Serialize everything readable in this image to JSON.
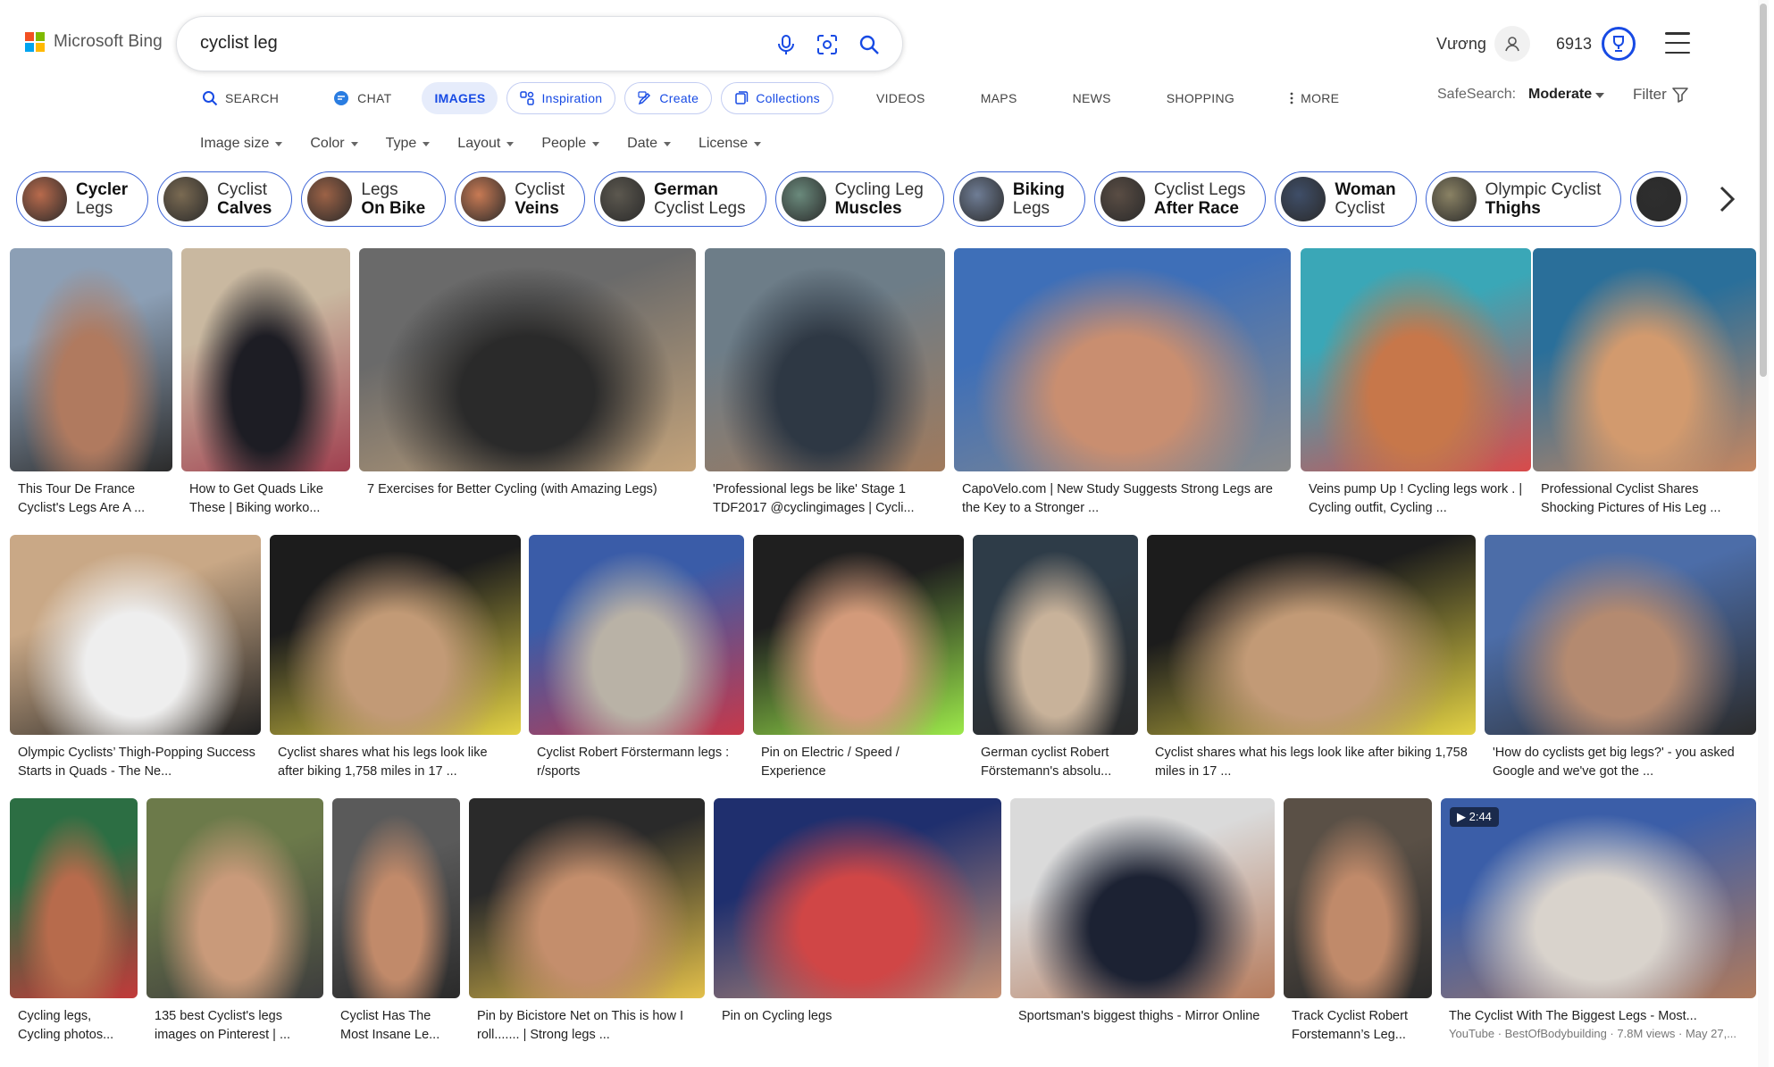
{
  "header": {
    "logo_text": "Microsoft Bing",
    "search_query": "cyclist leg",
    "user_name": "Vương",
    "points": "6913"
  },
  "nav": [
    {
      "label": "SEARCH",
      "icon": "search-icon",
      "style": "plain"
    },
    {
      "label": "CHAT",
      "icon": "copilot-icon",
      "style": "plain"
    },
    {
      "label": "IMAGES",
      "icon": "",
      "style": "active"
    },
    {
      "label": "Inspiration",
      "icon": "inspiration-icon",
      "style": "pill"
    },
    {
      "label": "Create",
      "icon": "create-icon",
      "style": "pill"
    },
    {
      "label": "Collections",
      "icon": "collections-icon",
      "style": "pill"
    },
    {
      "label": "VIDEOS",
      "icon": "",
      "style": "plain"
    },
    {
      "label": "MAPS",
      "icon": "",
      "style": "plain"
    },
    {
      "label": "NEWS",
      "icon": "",
      "style": "plain"
    },
    {
      "label": "SHOPPING",
      "icon": "",
      "style": "plain"
    },
    {
      "label": "MORE",
      "icon": "more-dots-icon",
      "style": "plain"
    }
  ],
  "safesearch": {
    "label": "SafeSearch:",
    "value": "Moderate"
  },
  "filter_label": "Filter",
  "filters": [
    "Image size",
    "Color",
    "Type",
    "Layout",
    "People",
    "Date",
    "License"
  ],
  "related": [
    {
      "line1": "Cycler",
      "line2": "Legs",
      "bold": 1,
      "thumb": "#b86a4c"
    },
    {
      "line1": "Cyclist",
      "line2": "Calves",
      "bold": 2,
      "thumb": "#7a6a52"
    },
    {
      "line1": "Legs",
      "line2": "On Bike",
      "bold": 2,
      "thumb": "#9c6246"
    },
    {
      "line1": "Cyclist",
      "line2": "Veins",
      "bold": 2,
      "thumb": "#c87a54"
    },
    {
      "line1": "German",
      "line2": "Cyclist Legs",
      "bold": 1,
      "thumb": "#5c584f"
    },
    {
      "line1": "Cycling Leg",
      "line2": "Muscles",
      "bold": 2,
      "thumb": "#6a8a7c"
    },
    {
      "line1": "Biking",
      "line2": "Legs",
      "bold": 1,
      "thumb": "#6f7d95"
    },
    {
      "line1": "Cyclist Legs",
      "line2": "After Race",
      "bold": 2,
      "thumb": "#5a4d44"
    },
    {
      "line1": "Woman",
      "line2": "Cyclist",
      "bold": 1,
      "thumb": "#3f4e68"
    },
    {
      "line1": "Olympic Cyclist",
      "line2": "Thighs",
      "bold": 2,
      "thumb": "#8a8264"
    },
    {
      "line1": "",
      "line2": "",
      "bold": 0,
      "thumb": "#2e2e2e"
    }
  ],
  "tiles": [
    {
      "caption": "This Tour De France Cyclist's Legs Are A ...",
      "colors": [
        "#8c9fb5",
        "#b07a5f",
        "#2b2b2b"
      ]
    },
    {
      "caption": "How to Get Quads Like These | Biking worko...",
      "colors": [
        "#c9b8a0",
        "#1d1d24",
        "#a04050"
      ]
    },
    {
      "caption": "7 Exercises for Better Cycling (with Amazing Legs)",
      "colors": [
        "#6a6a6a",
        "#2a2a2a",
        "#c4a37a"
      ]
    },
    {
      "caption": "'Professional legs be like' Stage 1 TDF2017 @cyclingimages | Cycli...",
      "colors": [
        "#6d7d88",
        "#2e3844",
        "#a07a5c"
      ]
    },
    {
      "caption": "CapoVelo.com | New Study Suggests Strong Legs are the Key to a Stronger ...",
      "colors": [
        "#3e6fb8",
        "#c98e70",
        "#8a8a8a"
      ]
    },
    {
      "caption": "Veins pump Up ! Cycling legs work . | Cycling outfit, Cycling ...",
      "colors": [
        "#3aa7b7",
        "#c7774a",
        "#d94a4a"
      ]
    },
    {
      "caption": "Professional Cyclist Shares Shocking Pictures of His Leg ...",
      "colors": [
        "#2a6f9a",
        "#d29a6e",
        "#c58660"
      ]
    },
    {
      "caption": "Olympic Cyclists’ Thigh-Popping Success Starts in Quads - The Ne...",
      "colors": [
        "#c9a886",
        "#eeeeee",
        "#202020"
      ]
    },
    {
      "caption": "Cyclist shares what his legs look like after biking 1,758 miles in 17 ...",
      "colors": [
        "#1c1c1c",
        "#c29a76",
        "#e3d244"
      ]
    },
    {
      "caption": "Cyclist Robert Förstermann legs : r/sports",
      "colors": [
        "#3a5ca8",
        "#b9b2a6",
        "#c7384a"
      ]
    },
    {
      "caption": "Pin on Electric / Speed / Experience",
      "colors": [
        "#1f1f1f",
        "#d39a7a",
        "#9ce94a"
      ]
    },
    {
      "caption": "German cyclist Robert Förstemann's absolu...",
      "colors": [
        "#2e3c48",
        "#c8b29a",
        "#2a2a2a"
      ]
    },
    {
      "caption": "Cyclist shares what his legs look like after biking 1,758 miles in 17 ...",
      "colors": [
        "#1c1c1c",
        "#c29a76",
        "#e3d244"
      ]
    },
    {
      "caption": "'How do cyclists get big legs?' - you asked Google and we've got the ...",
      "colors": [
        "#4c6da8",
        "#b48a70",
        "#2b2b2b"
      ]
    },
    {
      "caption": "Cycling legs, Cycling photos...",
      "colors": [
        "#2c6e43",
        "#b76b4c",
        "#c23a3a"
      ]
    },
    {
      "caption": "135 best Cyclist's legs images on Pinterest | ...",
      "colors": [
        "#6c7a4a",
        "#c99a7a",
        "#3d3d3d"
      ]
    },
    {
      "caption": "Cyclist Has The Most Insane Le...",
      "colors": [
        "#5a5a5a",
        "#c18a6a",
        "#2a2a2a"
      ]
    },
    {
      "caption": "Pin by Bicistore Net on This is how I roll....... | Strong legs ...",
      "colors": [
        "#2a2a2a",
        "#c48e6c",
        "#e3c04a"
      ]
    },
    {
      "caption": "Pin on Cycling legs",
      "colors": [
        "#1f2f6e",
        "#d04646",
        "#c89476"
      ]
    },
    {
      "caption": "Sportsman's biggest thighs - Mirror Online",
      "colors": [
        "#dadada",
        "#1c2233",
        "#b67b5c"
      ]
    },
    {
      "caption": "Track Cyclist Robert Forstemann’s Leg...",
      "colors": [
        "#5a5046",
        "#c08a6a",
        "#2a2a2a"
      ]
    },
    {
      "caption": "The Cyclist With The Biggest Legs - Most...",
      "source": "YouTube · BestOfBodybuilding · 7.8M views · May 27,...",
      "badge": "▶ 2:44",
      "colors": [
        "#3b5ea8",
        "#d9d3cc",
        "#b07a5c"
      ]
    }
  ]
}
